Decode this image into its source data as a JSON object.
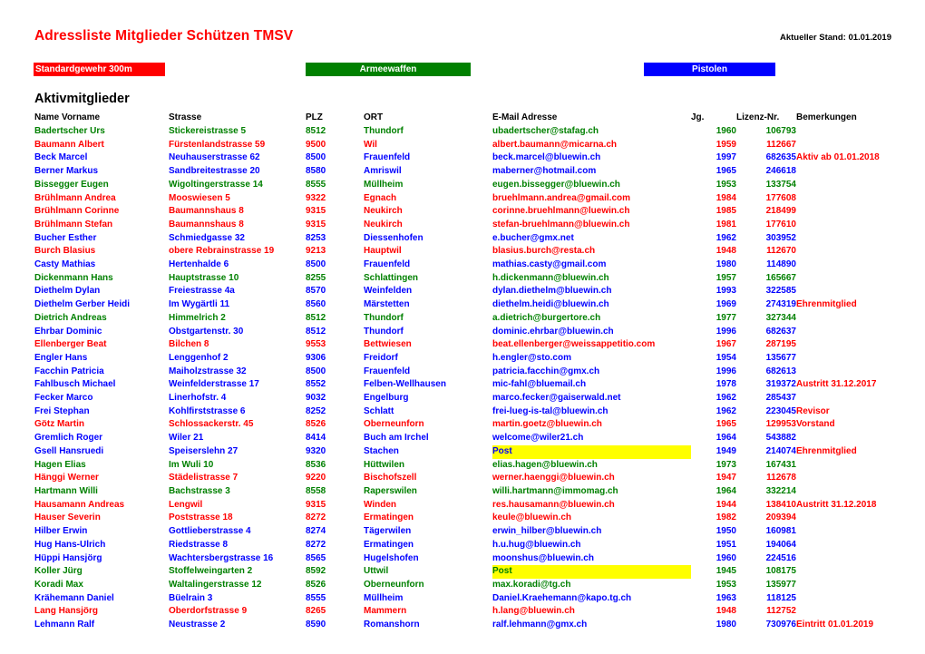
{
  "document": {
    "title": "Adressliste Mitglieder Schützen  TMSV",
    "status_label": "Aktueller Stand: 01.01.2019",
    "section_title": "Aktivmitglieder"
  },
  "legend": {
    "items": [
      {
        "label": "Standardgewehr 300m",
        "color": "#FF0000"
      },
      {
        "label": "Armeewaffen",
        "color": "#008000"
      },
      {
        "label": "Pistolen",
        "color": "#0000FF"
      }
    ]
  },
  "colors": {
    "red": "#FF0000",
    "green": "#008000",
    "blue": "#0000FF",
    "highlight": "#FFFF00",
    "text": "#000000"
  },
  "table": {
    "headers": [
      "Name Vorname",
      "Strasse",
      "PLZ",
      "ORT",
      "E-Mail Adresse",
      "Jg.",
      "Lizenz-Nr.",
      "Bemerkungen"
    ],
    "rows": [
      {
        "name": "Badertscher Urs",
        "strasse": "Stickereistrasse 5",
        "plz": "8512",
        "ort": "Thundorf",
        "email": "ubadertscher@stafag.ch",
        "jg": "1960",
        "lizenz": "106793",
        "bemerkung": "",
        "cat": "green",
        "email_highlight": false
      },
      {
        "name": "Baumann Albert",
        "strasse": "Fürstenlandstrasse 59",
        "plz": "9500",
        "ort": "Wil",
        "email": "albert.baumann@micarna.ch",
        "jg": "1959",
        "lizenz": "112667",
        "bemerkung": "",
        "cat": "red",
        "email_highlight": false
      },
      {
        "name": "Beck Marcel",
        "strasse": "Neuhauserstrasse 62",
        "plz": "8500",
        "ort": "Frauenfeld",
        "email": "beck.marcel@bluewin.ch",
        "jg": "1997",
        "lizenz": "682635",
        "bemerkung": "Aktiv ab 01.01.2018",
        "cat": "blue",
        "email_highlight": false
      },
      {
        "name": "Berner Markus",
        "strasse": "Sandbreitestrasse 20",
        "plz": "8580",
        "ort": "Amriswil",
        "email": "maberner@hotmail.com",
        "jg": "1965",
        "lizenz": "246618",
        "bemerkung": "",
        "cat": "blue",
        "email_highlight": false
      },
      {
        "name": "Bissegger Eugen",
        "strasse": "Wigoltingerstrasse 14",
        "plz": "8555",
        "ort": "Müllheim",
        "email": "eugen.bissegger@bluewin.ch",
        "jg": "1953",
        "lizenz": "133754",
        "bemerkung": "",
        "cat": "green",
        "email_highlight": false
      },
      {
        "name": "Brühlmann Andrea",
        "strasse": "Mooswiesen 5",
        "plz": "9322",
        "ort": "Egnach",
        "email": "bruehlmann.andrea@gmail.com",
        "jg": "1984",
        "lizenz": "177608",
        "bemerkung": "",
        "cat": "red",
        "email_highlight": false
      },
      {
        "name": "Brühlmann Corinne",
        "strasse": "Baumannshaus 8",
        "plz": "9315",
        "ort": "Neukirch",
        "email": "corinne.bruehlmann@luewin.ch",
        "jg": "1985",
        "lizenz": "218499",
        "bemerkung": "",
        "cat": "red",
        "email_highlight": false
      },
      {
        "name": "Brühlmann Stefan",
        "strasse": "Baumannshaus 8",
        "plz": "9315",
        "ort": "Neukirch",
        "email": "stefan-bruehlmann@bluewin.ch",
        "jg": "1981",
        "lizenz": "177610",
        "bemerkung": "",
        "cat": "red",
        "email_highlight": false
      },
      {
        "name": "Bucher Esther",
        "strasse": "Schmiedgasse 32",
        "plz": "8253",
        "ort": "Diessenhofen",
        "email": "e.bucher@gmx.net",
        "jg": "1962",
        "lizenz": "303952",
        "bemerkung": "",
        "cat": "blue",
        "email_highlight": false
      },
      {
        "name": "Burch Blasius",
        "strasse": "obere Rebrainstrasse 19",
        "plz": "9213",
        "ort": "Hauptwil",
        "email": "blasius.burch@resta.ch",
        "jg": "1948",
        "lizenz": "112670",
        "bemerkung": "",
        "cat": "red",
        "email_highlight": false
      },
      {
        "name": "Casty Mathias",
        "strasse": "Hertenhalde 6",
        "plz": "8500",
        "ort": "Frauenfeld",
        "email": "mathias.casty@gmail.com",
        "jg": "1980",
        "lizenz": "114890",
        "bemerkung": "",
        "cat": "blue",
        "email_highlight": false
      },
      {
        "name": "Dickenmann Hans",
        "strasse": "Hauptstrasse 10",
        "plz": "8255",
        "ort": "Schlattingen",
        "email": "h.dickenmann@bluewin.ch",
        "jg": "1957",
        "lizenz": "165667",
        "bemerkung": "",
        "cat": "green",
        "email_highlight": false
      },
      {
        "name": "Diethelm Dylan",
        "strasse": "Freiestrasse 4a",
        "plz": "8570",
        "ort": "Weinfelden",
        "email": "dylan.diethelm@bluewin.ch",
        "jg": "1993",
        "lizenz": "322585",
        "bemerkung": "",
        "cat": "blue",
        "email_highlight": false
      },
      {
        "name": "Diethelm Gerber Heidi",
        "strasse": "Im Wygärtli 11",
        "plz": "8560",
        "ort": "Märstetten",
        "email": "diethelm.heidi@bluewin.ch",
        "jg": "1969",
        "lizenz": "274319",
        "bemerkung": "Ehrenmitglied",
        "cat": "blue",
        "email_highlight": false
      },
      {
        "name": "Dietrich Andreas",
        "strasse": "Himmelrich 2",
        "plz": "8512",
        "ort": "Thundorf",
        "email": "a.dietrich@burgertore.ch",
        "jg": "1977",
        "lizenz": "327344",
        "bemerkung": "",
        "cat": "green",
        "email_highlight": false
      },
      {
        "name": "Ehrbar Dominic",
        "strasse": "Obstgartenstr. 30",
        "plz": "8512",
        "ort": "Thundorf",
        "email": "dominic.ehrbar@bluewin.ch",
        "jg": "1996",
        "lizenz": "682637",
        "bemerkung": "",
        "cat": "blue",
        "email_highlight": false
      },
      {
        "name": "Ellenberger Beat",
        "strasse": "Bilchen 8",
        "plz": "9553",
        "ort": "Bettwiesen",
        "email": "beat.ellenberger@weissappetitio.com",
        "jg": "1967",
        "lizenz": "287195",
        "bemerkung": "",
        "cat": "red",
        "email_highlight": false
      },
      {
        "name": "Engler Hans",
        "strasse": "Lenggenhof 2",
        "plz": "9306",
        "ort": "Freidorf",
        "email": "h.engler@sto.com",
        "jg": "1954",
        "lizenz": "135677",
        "bemerkung": "",
        "cat": "blue",
        "email_highlight": false
      },
      {
        "name": "Facchin Patricia",
        "strasse": "Maiholzstrasse 32",
        "plz": "8500",
        "ort": "Frauenfeld",
        "email": "patricia.facchin@gmx.ch",
        "jg": "1996",
        "lizenz": "682613",
        "bemerkung": "",
        "cat": "blue",
        "email_highlight": false
      },
      {
        "name": "Fahlbusch Michael",
        "strasse": "Weinfelderstrasse 17",
        "plz": "8552",
        "ort": "Felben-Wellhausen",
        "email": "mic-fahl@bluemail.ch",
        "jg": "1978",
        "lizenz": "319372",
        "bemerkung": "Austritt 31.12.2017",
        "cat": "blue",
        "email_highlight": false
      },
      {
        "name": "Fecker Marco",
        "strasse": "Linerhofstr. 4",
        "plz": "9032",
        "ort": "Engelburg",
        "email": "marco.fecker@gaiserwald.net",
        "jg": "1962",
        "lizenz": "285437",
        "bemerkung": "",
        "cat": "blue",
        "email_highlight": false
      },
      {
        "name": "Frei Stephan",
        "strasse": "Kohlfirststrasse 6",
        "plz": "8252",
        "ort": "Schlatt",
        "email": "frei-lueg-is-tal@bluewin.ch",
        "jg": "1962",
        "lizenz": "223045",
        "bemerkung": "Revisor",
        "cat": "blue",
        "email_highlight": false
      },
      {
        "name": "Götz Martin",
        "strasse": "Schlossackerstr. 45",
        "plz": "8526",
        "ort": "Oberneunforn",
        "email": "martin.goetz@bluewin.ch",
        "jg": "1965",
        "lizenz": "129953",
        "bemerkung": "Vorstand",
        "cat": "red",
        "email_highlight": false
      },
      {
        "name": "Gremlich Roger",
        "strasse": "Wiler 21",
        "plz": "8414",
        "ort": "Buch am Irchel",
        "email": "welcome@wiler21.ch",
        "jg": "1964",
        "lizenz": "543882",
        "bemerkung": "",
        "cat": "blue",
        "email_highlight": false
      },
      {
        "name": "Gsell Hansruedi",
        "strasse": "Speiserslehn 27",
        "plz": "9320",
        "ort": "Stachen",
        "email": "Post",
        "jg": "1949",
        "lizenz": "214074",
        "bemerkung": "Ehrenmitglied",
        "cat": "blue",
        "email_highlight": true
      },
      {
        "name": "Hagen Elias",
        "strasse": "Im Wuli 10",
        "plz": "8536",
        "ort": "Hüttwilen",
        "email": "elias.hagen@bluewin.ch",
        "jg": "1973",
        "lizenz": "167431",
        "bemerkung": "",
        "cat": "green",
        "email_highlight": false
      },
      {
        "name": "Hänggi Werner",
        "strasse": "Städelistrasse 7",
        "plz": "9220",
        "ort": "Bischofszell",
        "email": "werner.haenggi@bluewin.ch",
        "jg": "1947",
        "lizenz": "112678",
        "bemerkung": "",
        "cat": "red",
        "email_highlight": false
      },
      {
        "name": "Hartmann Willi",
        "strasse": "Bachstrasse 3",
        "plz": "8558",
        "ort": "Raperswilen",
        "email": "willi.hartmann@immomag.ch",
        "jg": "1964",
        "lizenz": "332214",
        "bemerkung": "",
        "cat": "green",
        "email_highlight": false
      },
      {
        "name": "Hausamann Andreas",
        "strasse": "Lengwil",
        "plz": "9315",
        "ort": "Winden",
        "email": "res.hausamann@bluewin.ch",
        "jg": "1944",
        "lizenz": "138410",
        "bemerkung": "Austritt 31.12.2018",
        "cat": "red",
        "email_highlight": false
      },
      {
        "name": "Hauser Severin",
        "strasse": "Poststrasse 18",
        "plz": "8272",
        "ort": "Ermatingen",
        "email": "keule@bluewin.ch",
        "jg": "1982",
        "lizenz": "209394",
        "bemerkung": "",
        "cat": "red",
        "email_highlight": false
      },
      {
        "name": "Hilber Erwin",
        "strasse": "Gottlieberstrasse 4",
        "plz": "8274",
        "ort": "Tägerwilen",
        "email": "erwin_hilber@bluewin.ch",
        "jg": "1950",
        "lizenz": "160981",
        "bemerkung": "",
        "cat": "blue",
        "email_highlight": false
      },
      {
        "name": "Hug Hans-Ulrich",
        "strasse": "Riedstrasse 8",
        "plz": "8272",
        "ort": "Ermatingen",
        "email": "h.u.hug@bluewin.ch",
        "jg": "1951",
        "lizenz": "194064",
        "bemerkung": "",
        "cat": "blue",
        "email_highlight": false
      },
      {
        "name": "Hüppi Hansjörg",
        "strasse": "Wachtersbergstrasse 16",
        "plz": "8565",
        "ort": "Hugelshofen",
        "email": "moonshus@bluewin.ch",
        "jg": "1960",
        "lizenz": "224516",
        "bemerkung": "",
        "cat": "blue",
        "email_highlight": false
      },
      {
        "name": "Koller Jürg",
        "strasse": "Stoffelweingarten 2",
        "plz": "8592",
        "ort": "Uttwil",
        "email": "Post",
        "jg": "1945",
        "lizenz": "108175",
        "bemerkung": "",
        "cat": "green",
        "email_highlight": true
      },
      {
        "name": "Koradi Max",
        "strasse": "Waltalingerstrasse 12",
        "plz": "8526",
        "ort": "Oberneunforn",
        "email": "max.koradi@tg.ch",
        "jg": "1953",
        "lizenz": "135977",
        "bemerkung": "",
        "cat": "green",
        "email_highlight": false
      },
      {
        "name": "Krähemann Daniel",
        "strasse": "Büelrain 3",
        "plz": "8555",
        "ort": "Müllheim",
        "email": "Daniel.Kraehemann@kapo.tg.ch",
        "jg": "1963",
        "lizenz": "118125",
        "bemerkung": "",
        "cat": "blue",
        "email_highlight": false
      },
      {
        "name": "Lang Hansjörg",
        "strasse": "Oberdorfstrasse 9",
        "plz": "8265",
        "ort": "Mammern",
        "email": "h.lang@bluewin.ch",
        "jg": "1948",
        "lizenz": "112752",
        "bemerkung": "",
        "cat": "red",
        "email_highlight": false
      },
      {
        "name": "Lehmann Ralf",
        "strasse": "Neustrasse 2",
        "plz": "8590",
        "ort": "Romanshorn",
        "email": "ralf.lehmann@gmx.ch",
        "jg": "1980",
        "lizenz": "730976",
        "bemerkung": "Eintritt 01.01.2019",
        "cat": "blue",
        "email_highlight": false
      }
    ]
  }
}
